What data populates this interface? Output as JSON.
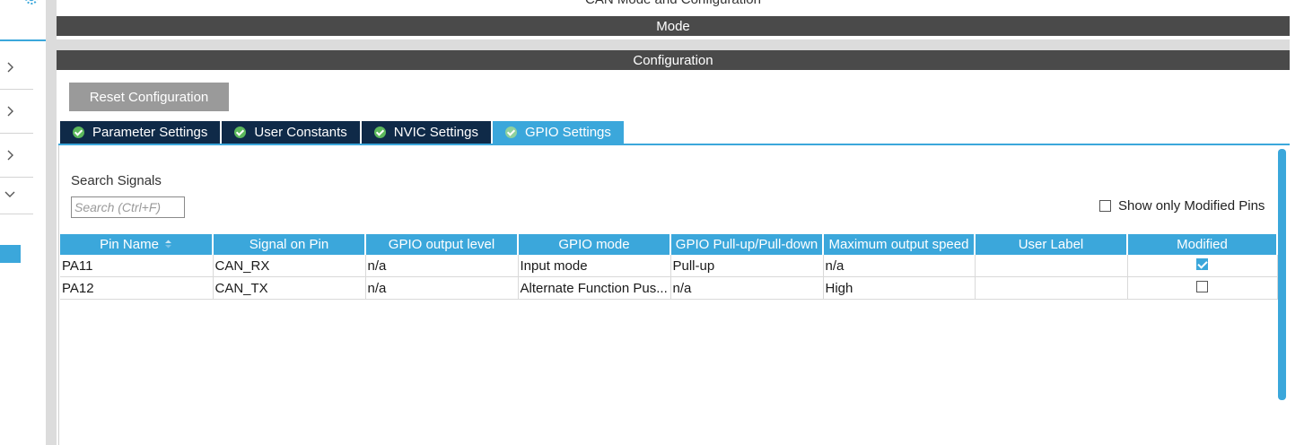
{
  "header": {
    "partial_title": "CAN Mode and Configuration",
    "mode_label": "Mode",
    "configuration_label": "Configuration"
  },
  "toolbar": {
    "reset_label": "Reset Configuration"
  },
  "tabs": [
    {
      "label": "Parameter Settings",
      "active": false,
      "icon": "check-circle-icon"
    },
    {
      "label": "User Constants",
      "active": false,
      "icon": "check-circle-icon"
    },
    {
      "label": "NVIC Settings",
      "active": false,
      "icon": "check-circle-icon"
    },
    {
      "label": "GPIO Settings",
      "active": true,
      "icon": "check-circle-icon"
    }
  ],
  "search": {
    "label": "Search Signals",
    "placeholder": "Search (Ctrl+F)",
    "value": ""
  },
  "filter": {
    "show_modified_label": "Show only Modified Pins",
    "checked": false
  },
  "table": {
    "columns": [
      "Pin Name",
      "Signal on Pin",
      "GPIO output level",
      "GPIO mode",
      "GPIO Pull-up/Pull-down",
      "Maximum output speed",
      "User Label",
      "Modified"
    ],
    "rows": [
      {
        "pin": "PA11",
        "signal": "CAN_RX",
        "output_level": "n/a",
        "mode": "Input mode",
        "pull": "Pull-up",
        "speed": "n/a",
        "user_label": "",
        "modified": true
      },
      {
        "pin": "PA12",
        "signal": "CAN_TX",
        "output_level": "n/a",
        "mode": "Alternate Function Pus...",
        "pull": "n/a",
        "speed": "High",
        "user_label": "",
        "modified": false
      }
    ]
  },
  "colors": {
    "accent": "#3ba7db",
    "tab_dark": "#0f2a48",
    "bar_dark": "#4a4a4a",
    "button_gray": "#9a9a9a",
    "ok_green": "#5cb85c"
  }
}
